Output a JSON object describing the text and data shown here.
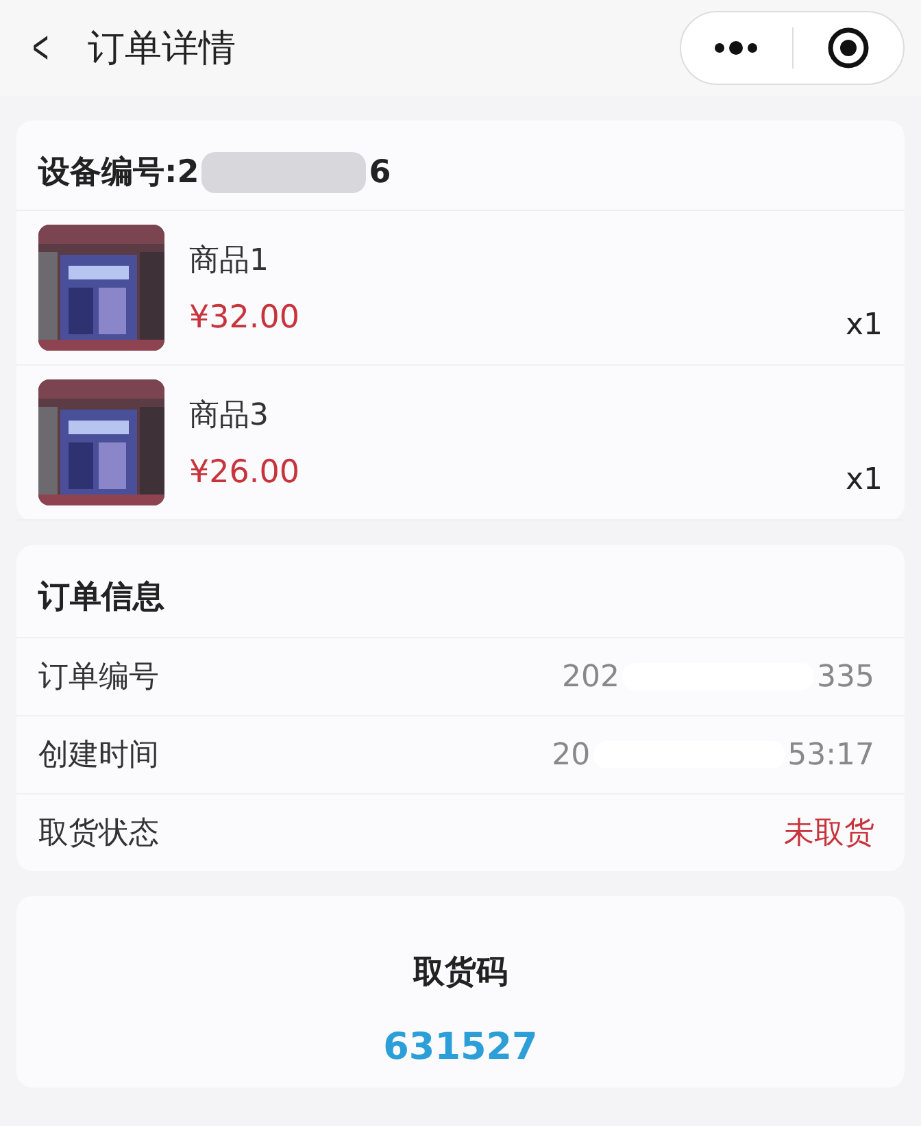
{
  "nav": {
    "back": "<",
    "title": "订单详情"
  },
  "device": {
    "label": "设备编号:",
    "value_start": "2",
    "value_end": "6"
  },
  "products": [
    {
      "name": "商品1",
      "price": "¥32.00",
      "qty": "x1"
    },
    {
      "name": "商品3",
      "price": "¥26.00",
      "qty": "x1"
    }
  ],
  "order_info": {
    "title": "订单信息",
    "rows": [
      {
        "label": "订单编号",
        "value_start": "202",
        "value_end": "335",
        "redacted": true
      },
      {
        "label": "创建时间",
        "value_start": "20",
        "value_end": "53:17",
        "redacted": true
      },
      {
        "label": "取货状态",
        "value_start": "未取货",
        "value_end": "",
        "redacted": false,
        "kind": "status"
      }
    ]
  },
  "pickup": {
    "title": "取货码",
    "code": "631527"
  }
}
